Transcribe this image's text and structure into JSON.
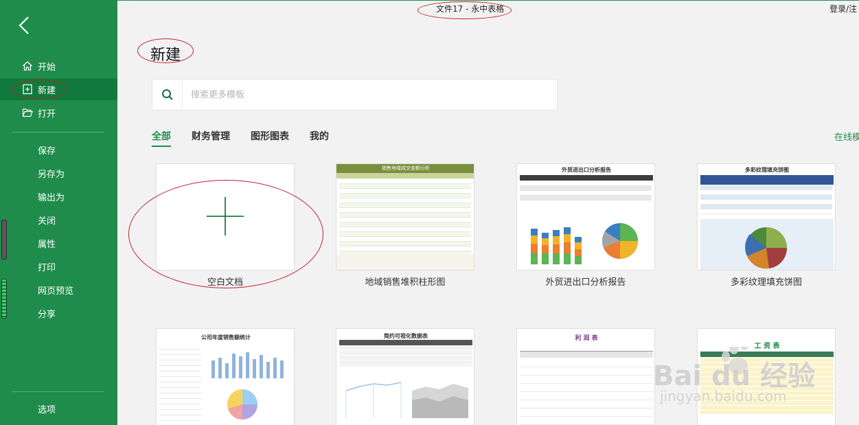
{
  "window": {
    "title": "文件17 - 永中表格",
    "login": "登录/注"
  },
  "sidebar": {
    "back": "back",
    "top_items": [
      {
        "label": "开始",
        "icon": "home-icon"
      },
      {
        "label": "新建",
        "icon": "new-file-icon",
        "selected": true
      },
      {
        "label": "打开",
        "icon": "folder-open-icon"
      }
    ],
    "menu_items": [
      "保存",
      "另存为",
      "输出为",
      "关闭",
      "属性",
      "打印",
      "网页预览",
      "分享"
    ],
    "options_label": "选项"
  },
  "main": {
    "title": "新建",
    "search": {
      "placeholder": "搜索更多模板"
    },
    "tabs": [
      {
        "label": "全部",
        "active": true
      },
      {
        "label": "财务管理"
      },
      {
        "label": "图形图表"
      },
      {
        "label": "我的"
      }
    ],
    "online_templates": "在线模",
    "cards_row1": [
      {
        "label": "空白文档"
      },
      {
        "label": "地域销售堆积柱形图",
        "thumb_title": "销售地域成交金额分析"
      },
      {
        "label": "外贸进出口分析报告",
        "thumb_title": "外贸进出口分析报告"
      },
      {
        "label": "多彩纹理填充饼图",
        "thumb_title": "多彩纹理填充饼图"
      }
    ],
    "cards_row2": [
      {
        "thumb_title": "公司年度销售额统计"
      },
      {
        "thumb_title": "简约可视化数据表"
      },
      {
        "thumb_title": "利 润 表"
      },
      {
        "thumb_title": "工 资 表"
      }
    ]
  },
  "watermark": {
    "text": "Bai du 经验",
    "sub": "jingyan.baidu.com"
  },
  "colors": {
    "accent": "#1f8c4b",
    "selected": "#0f7a3c",
    "annotation": "#c0202a"
  }
}
